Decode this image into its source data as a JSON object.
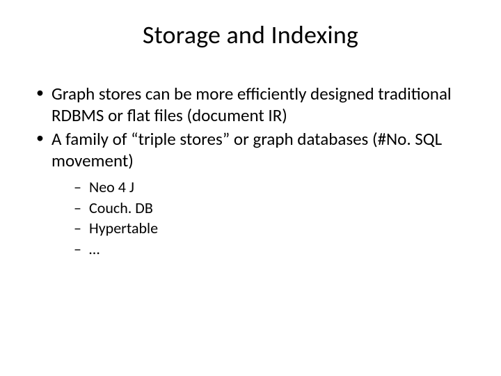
{
  "title": "Storage and Indexing",
  "bullets": [
    "Graph stores can be more efficiently designed traditional RDBMS or flat files (document IR)",
    "A family of “triple stores” or graph databases (#No. SQL movement)"
  ],
  "sub_bullets": [
    "Neo 4 J",
    "Couch. DB",
    "Hypertable",
    "…"
  ]
}
